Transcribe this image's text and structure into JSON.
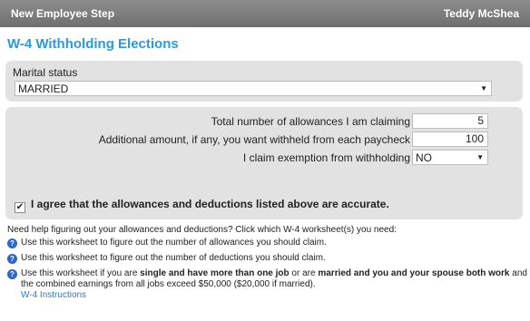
{
  "topbar": {
    "step": "New Employee Step",
    "user": "Teddy McShea"
  },
  "heading": "W-4 Withholding Elections",
  "marital": {
    "label": "Marital status",
    "value": "MARRIED"
  },
  "allowances": {
    "label": "Total number of allowances I am claiming",
    "value": "5"
  },
  "additional": {
    "label": "Additional amount, if any, you want withheld from each paycheck",
    "value": "100"
  },
  "exemption": {
    "label": "I claim exemption from withholding",
    "value": "NO"
  },
  "agree": {
    "label": "I agree that the allowances and deductions listed above are accurate.",
    "checked": true
  },
  "help": {
    "text": "Need help figuring out your allowances and deductions? Click which W-4 worksheet(s) you need:",
    "ws1": "Use this worksheet to figure out the number of allowances you should claim.",
    "ws2": "Use this worksheet to figure out the number of deductions you should claim.",
    "ws3_pre": "Use this worksheet if you are ",
    "ws3_b1": "single and have more than one job",
    "ws3_mid": " or are ",
    "ws3_b2": "married and you and your spouse both work",
    "ws3_post": " and the combined earnings from all jobs exceed $50,000 ($20,000 if married).",
    "link": "W-4 Instructions"
  },
  "icons": {
    "help": "question-circle-icon",
    "dropdown": "triangle-down-icon",
    "check": "checkmark-icon"
  }
}
